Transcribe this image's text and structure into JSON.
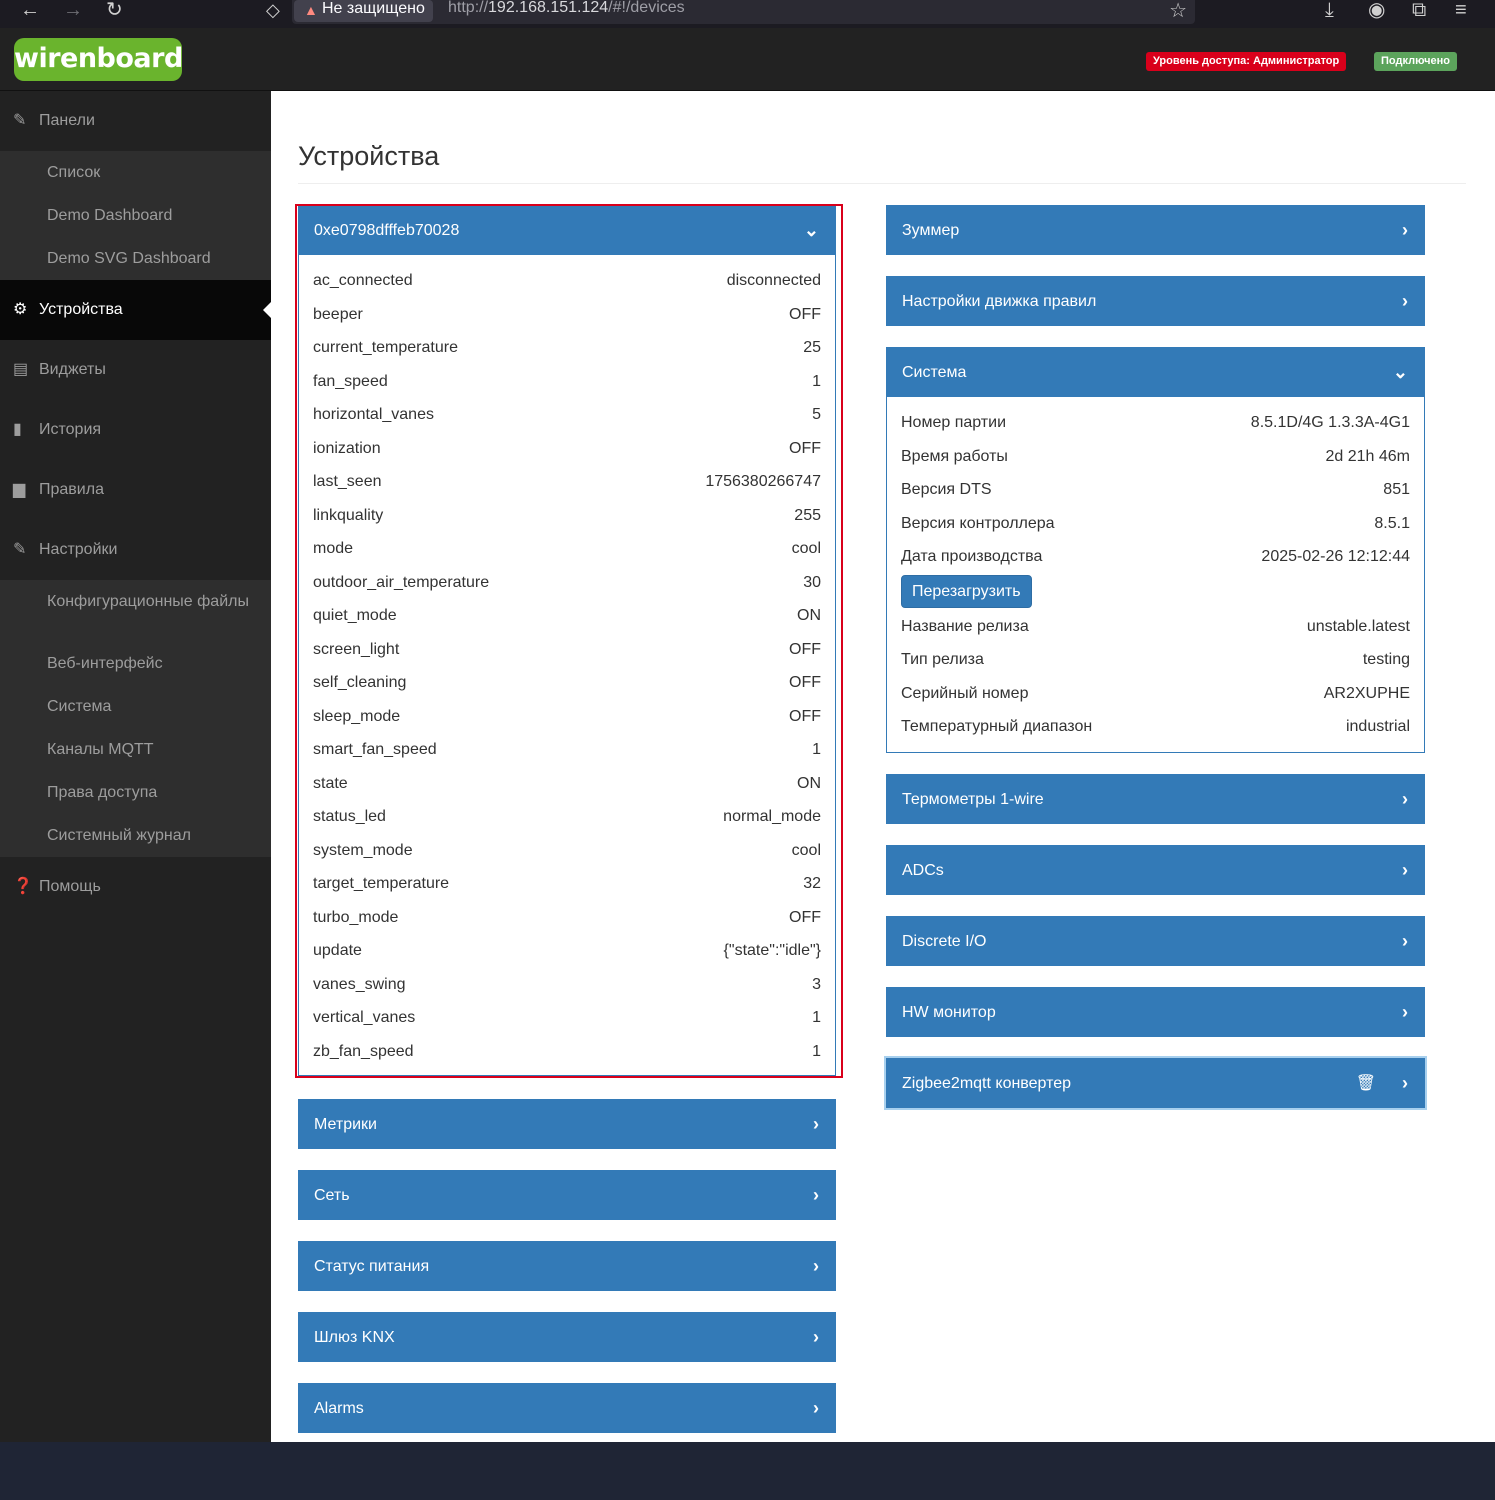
{
  "browser": {
    "insecure_label": "Не защищено",
    "url_prefix": "http://",
    "url_host": "192.168.151.124",
    "url_path": "/#!/devices"
  },
  "header": {
    "logo": "wirenboard",
    "access_badge": "Уровень доступа: Администратор",
    "connection_badge": "Подключено"
  },
  "sidebar": {
    "panels": "Панели",
    "panels_items": [
      "Список",
      "Demo Dashboard",
      "Demo SVG Dashboard"
    ],
    "devices": "Устройства",
    "widgets": "Виджеты",
    "history": "История",
    "rules": "Правила",
    "settings": "Настройки",
    "settings_items": [
      "Конфигурационные файлы",
      "Веб-интерфейс",
      "Система",
      "Каналы MQTT",
      "Права доступа",
      "Системный журнал"
    ],
    "help": "Помощь"
  },
  "page": {
    "title": "Устройства"
  },
  "device_main": {
    "title": "0xe0798dfffeb70028",
    "rows": [
      {
        "k": "ac_connected",
        "v": "disconnected"
      },
      {
        "k": "beeper",
        "v": "OFF"
      },
      {
        "k": "current_temperature",
        "v": "25"
      },
      {
        "k": "fan_speed",
        "v": "1"
      },
      {
        "k": "horizontal_vanes",
        "v": "5"
      },
      {
        "k": "ionization",
        "v": "OFF"
      },
      {
        "k": "last_seen",
        "v": "1756380266747"
      },
      {
        "k": "linkquality",
        "v": "255"
      },
      {
        "k": "mode",
        "v": "cool"
      },
      {
        "k": "outdoor_air_temperature",
        "v": "30"
      },
      {
        "k": "quiet_mode",
        "v": "ON"
      },
      {
        "k": "screen_light",
        "v": "OFF"
      },
      {
        "k": "self_cleaning",
        "v": "OFF"
      },
      {
        "k": "sleep_mode",
        "v": "OFF"
      },
      {
        "k": "smart_fan_speed",
        "v": "1"
      },
      {
        "k": "state",
        "v": "ON"
      },
      {
        "k": "status_led",
        "v": "normal_mode"
      },
      {
        "k": "system_mode",
        "v": "cool"
      },
      {
        "k": "target_temperature",
        "v": "32"
      },
      {
        "k": "turbo_mode",
        "v": "OFF"
      },
      {
        "k": "update",
        "v": "{\"state\":\"idle\"}"
      },
      {
        "k": "vanes_swing",
        "v": "3"
      },
      {
        "k": "vertical_vanes",
        "v": "1"
      },
      {
        "k": "zb_fan_speed",
        "v": "1"
      }
    ]
  },
  "left_panels": [
    "Метрики",
    "Сеть",
    "Статус питания",
    "Шлюз KNX",
    "Alarms"
  ],
  "right_panels_top": [
    "Зуммер",
    "Настройки движка правил"
  ],
  "system": {
    "title": "Система",
    "rows_a": [
      {
        "k": "Номер партии",
        "v": "8.5.1D/4G 1.3.3A-4G1"
      },
      {
        "k": "Время работы",
        "v": "2d 21h 46m"
      },
      {
        "k": "Версия DTS",
        "v": "851"
      },
      {
        "k": "Версия контроллера",
        "v": "8.5.1"
      },
      {
        "k": "Дата производства",
        "v": "2025-02-26 12:12:44"
      }
    ],
    "reboot_label": "Перезагрузить",
    "rows_b": [
      {
        "k": "Название релиза",
        "v": "unstable.latest"
      },
      {
        "k": "Тип релиза",
        "v": "testing"
      },
      {
        "k": "Серийный номер",
        "v": "AR2XUPHE"
      },
      {
        "k": "Температурный диапазон",
        "v": "industrial"
      }
    ]
  },
  "right_panels_bottom": [
    "Термометры 1-wire",
    "ADCs",
    "Discrete I/O",
    "HW монитор"
  ],
  "zigbee_panel": "Zigbee2mqtt конвертер",
  "icons": {
    "chevron_right": "›",
    "chevron_down": "⌄",
    "wrench": "🔧",
    "gear": "⚙",
    "list": "▤",
    "chart": "▮",
    "file": "▆",
    "help": "?",
    "trash": "🗑"
  },
  "colors": {
    "panel_blue": "#337ab7",
    "logo_green": "#6ab42d",
    "admin_red": "#d9001b",
    "connected_green": "#5ca45c"
  }
}
